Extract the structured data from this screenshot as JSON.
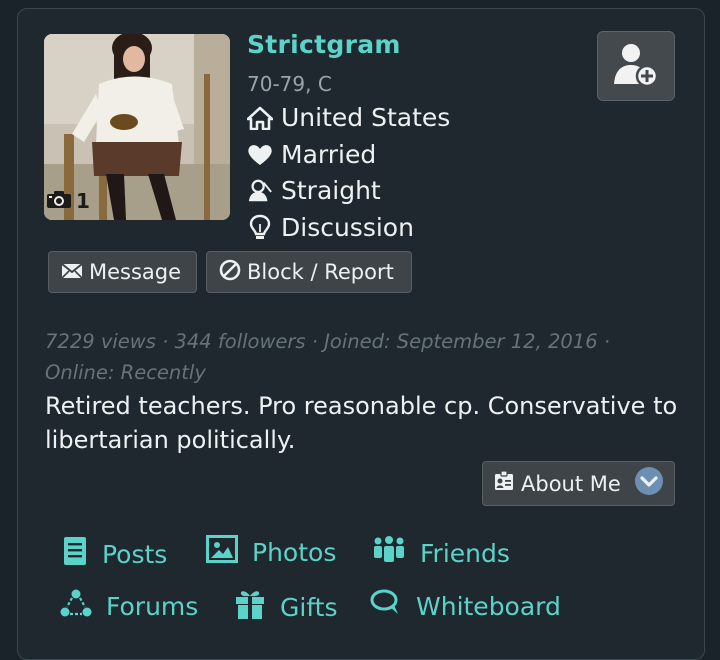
{
  "profile": {
    "username": "Strictgram",
    "age_role": "70-79, C",
    "photo_count": "1",
    "location": "United States",
    "relationship": "Married",
    "orientation": "Straight",
    "interest": "Discussion"
  },
  "actions": {
    "message_label": "Message",
    "block_label": "Block / Report",
    "about_label": "About Me"
  },
  "stats": {
    "line": "7229 views · 344 followers · Joined: September 12, 2016 · Online: Recently"
  },
  "bio": "Retired teachers. Pro reasonable cp. Conservative to libertarian politically.",
  "nav": {
    "posts": "Posts",
    "photos": "Photos",
    "friends": "Friends",
    "forums": "Forums",
    "gifts": "Gifts",
    "whiteboard": "Whiteboard"
  },
  "colors": {
    "accent": "#5bd3c8",
    "background": "#1e282e",
    "muted_text": "#66737a"
  }
}
